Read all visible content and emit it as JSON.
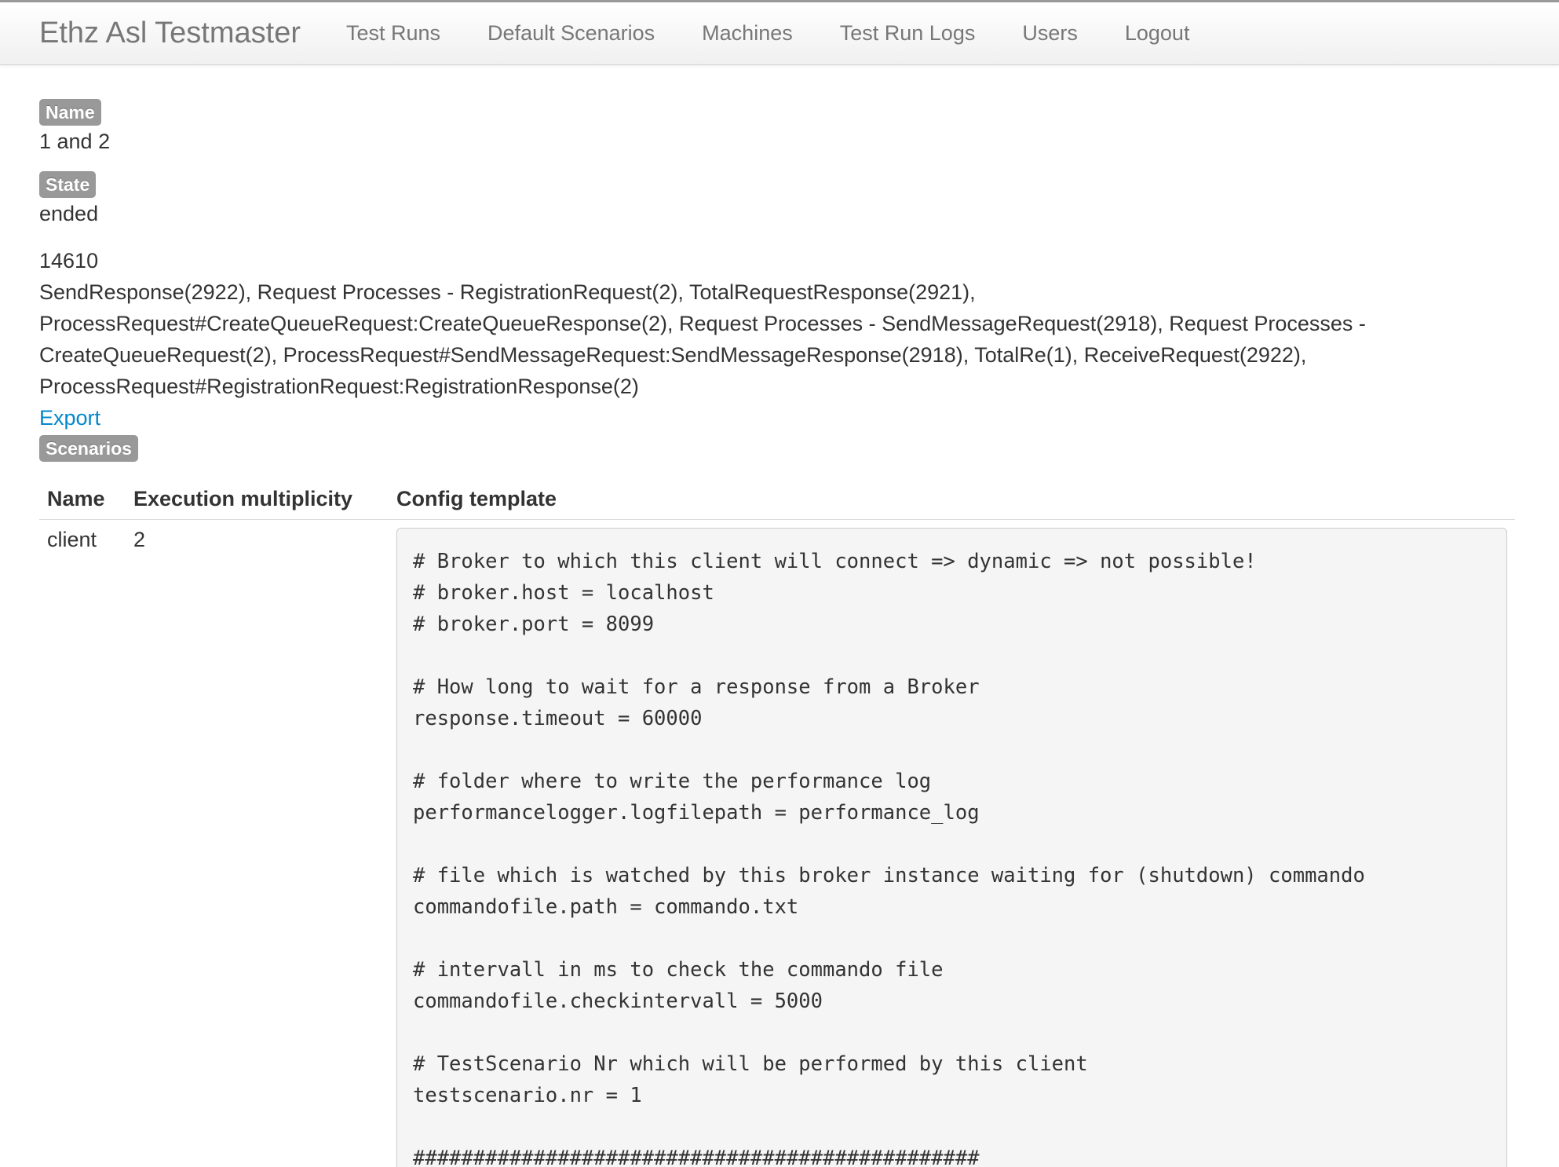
{
  "navbar": {
    "brand": "Ethz Asl Testmaster",
    "links": [
      {
        "label": "Test Runs"
      },
      {
        "label": "Default Scenarios"
      },
      {
        "label": "Machines"
      },
      {
        "label": "Test Run Logs"
      },
      {
        "label": "Users"
      },
      {
        "label": "Logout"
      }
    ]
  },
  "details": {
    "name_label": "Name",
    "name_value": "1 and 2",
    "state_label": "State",
    "state_value": "ended",
    "count": "14610",
    "summary": "SendResponse(2922), Request Processes - RegistrationRequest(2), TotalRequestResponse(2921), ProcessRequest#CreateQueueRequest:CreateQueueResponse(2), Request Processes - SendMessageRequest(2918), Request Processes - CreateQueueRequest(2), ProcessRequest#SendMessageRequest:SendMessageResponse(2918), TotalRe(1), ReceiveRequest(2922), ProcessRequest#RegistrationRequest:RegistrationResponse(2)",
    "export_label": "Export",
    "scenarios_label": "Scenarios"
  },
  "table": {
    "headers": [
      "Name",
      "Execution multiplicity",
      "Config template"
    ],
    "rows": [
      {
        "name": "client",
        "multiplicity": "2",
        "config": "# Broker to which this client will connect => dynamic => not possible!\n# broker.host = localhost\n# broker.port = 8099\n\n# How long to wait for a response from a Broker\nresponse.timeout = 60000\n\n# folder where to write the performance log\nperformancelogger.logfilepath = performance_log\n\n# file which is watched by this broker instance waiting for (shutdown) commando\ncommandofile.path = commando.txt\n\n# intervall in ms to check the commando file\ncommandofile.checkintervall = 5000\n\n# TestScenario Nr which will be performed by this client\ntestscenario.nr = 1\n\n###############################################"
      }
    ]
  }
}
